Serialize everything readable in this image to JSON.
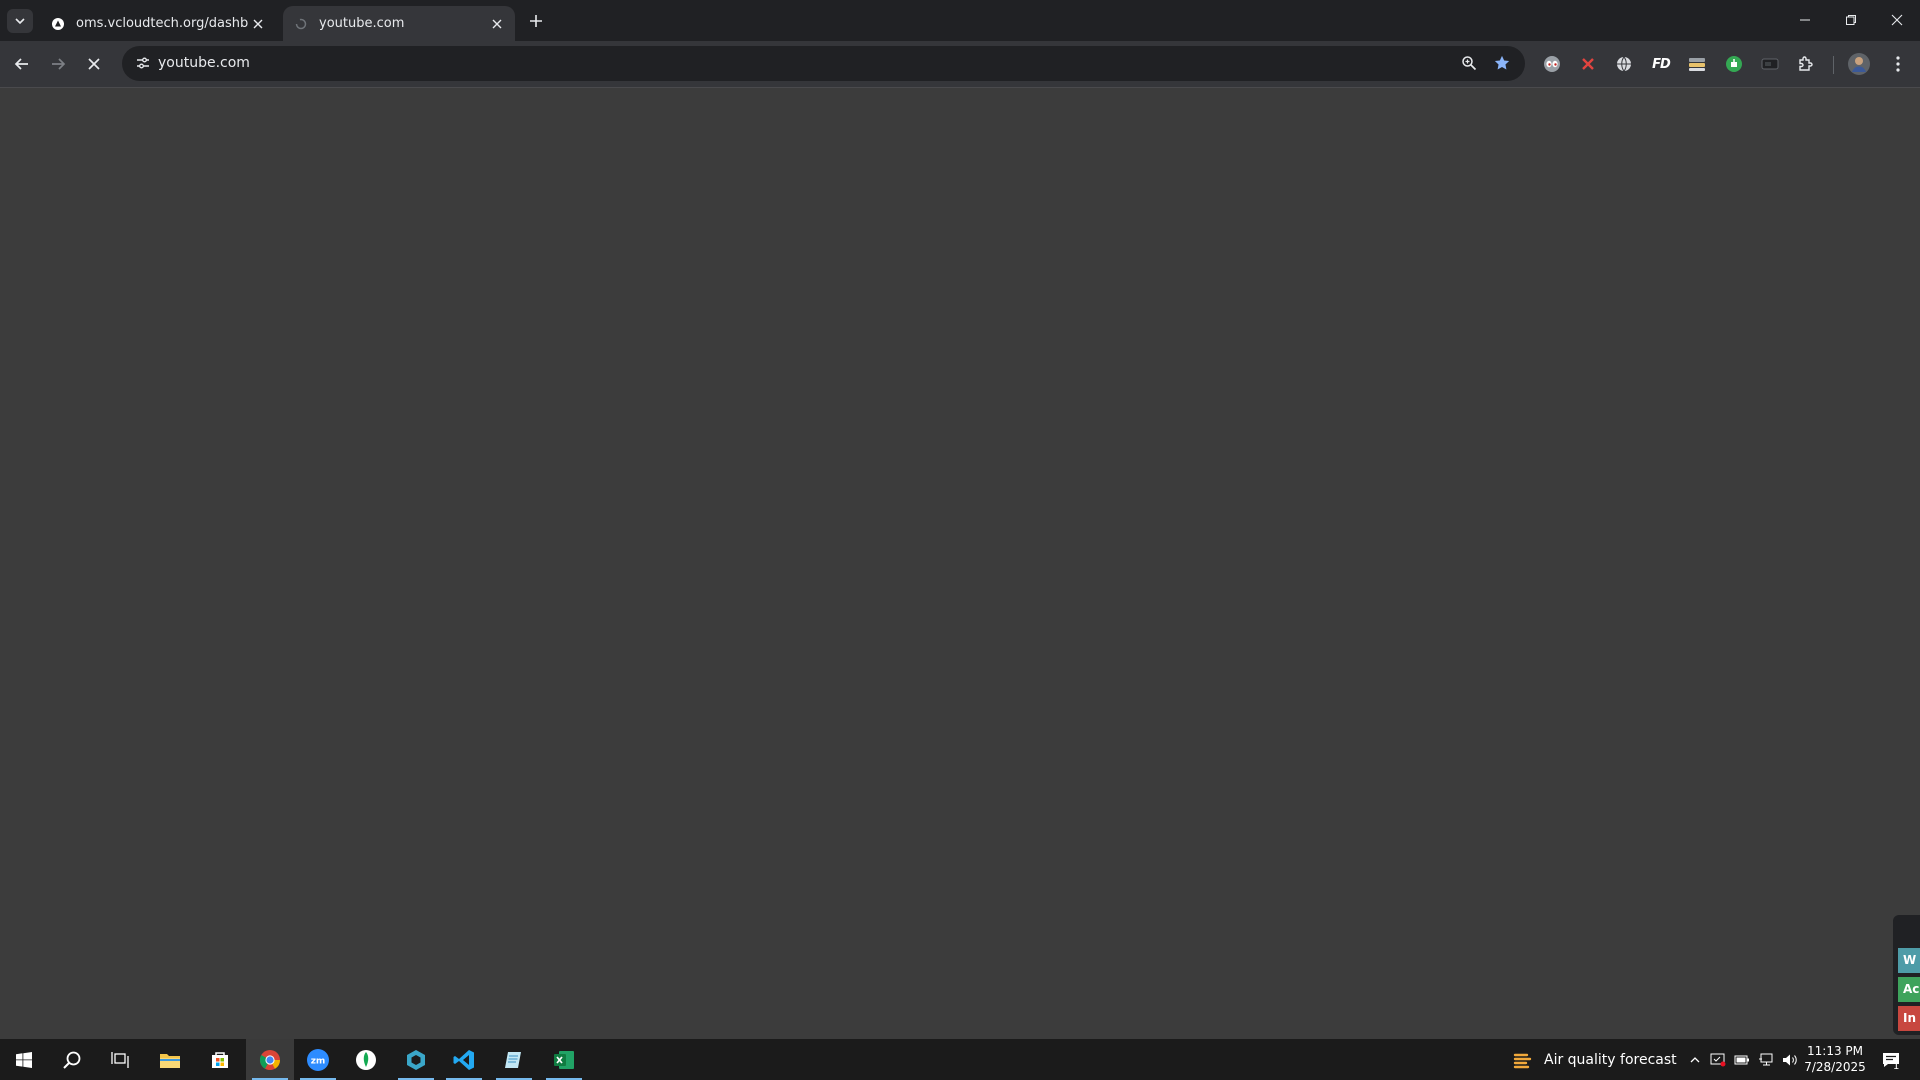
{
  "browser": {
    "tabs": [
      {
        "title": "oms.vcloudtech.org/dashboard",
        "active": false
      },
      {
        "title": "youtube.com",
        "active": true
      }
    ],
    "address": {
      "url": "youtube.com"
    },
    "extensions": [
      "eyes-extension-icon",
      "red-x-extension-icon",
      "globe-extension-icon",
      "fd-extension-icon",
      "stack-extension-icon",
      "green-extension-icon",
      "dark-extension-icon",
      "puzzle-icon"
    ],
    "fd_label": "FD"
  },
  "side_widget": {
    "items": [
      {
        "label": "W",
        "color": "#4e9ca8"
      },
      {
        "label": "Ac",
        "color": "#3ea35c"
      },
      {
        "label": "In",
        "color": "#c8473f"
      }
    ]
  },
  "taskbar": {
    "weather": {
      "label": "Air quality forecast"
    },
    "clock": {
      "time": "11:13 PM",
      "date": "7/28/2025"
    },
    "notifications": {
      "count": "1"
    }
  },
  "colors": {
    "page_bg": "#3c3c3c",
    "tabstrip": "#202124",
    "toolbar": "#35363a",
    "accent_star": "#8ab4f8",
    "taskbar": "#1b1b1b"
  }
}
